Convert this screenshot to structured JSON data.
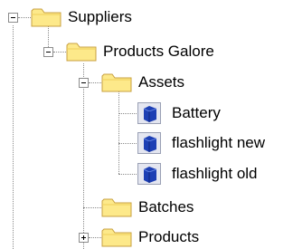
{
  "tree": {
    "suppliers": {
      "label": "Suppliers"
    },
    "products_galore": {
      "label": "Products Galore"
    },
    "assets": {
      "label": "Assets"
    },
    "battery": {
      "label": "Battery"
    },
    "flashlight_new": {
      "label": "flashlight new"
    },
    "flashlight_old": {
      "label": "flashlight old"
    },
    "batches": {
      "label": "Batches"
    },
    "products": {
      "label": "Products"
    }
  },
  "icons": {
    "folder": "folder-icon",
    "item": "cube-icon",
    "expanded": "minus-expander-icon",
    "collapsed": "plus-expander-icon"
  },
  "colors": {
    "folder_fill": "#fde98a",
    "folder_stroke": "#c8a040",
    "cube_blue": "#1d3fb4",
    "connector": "#8a8a8a"
  }
}
